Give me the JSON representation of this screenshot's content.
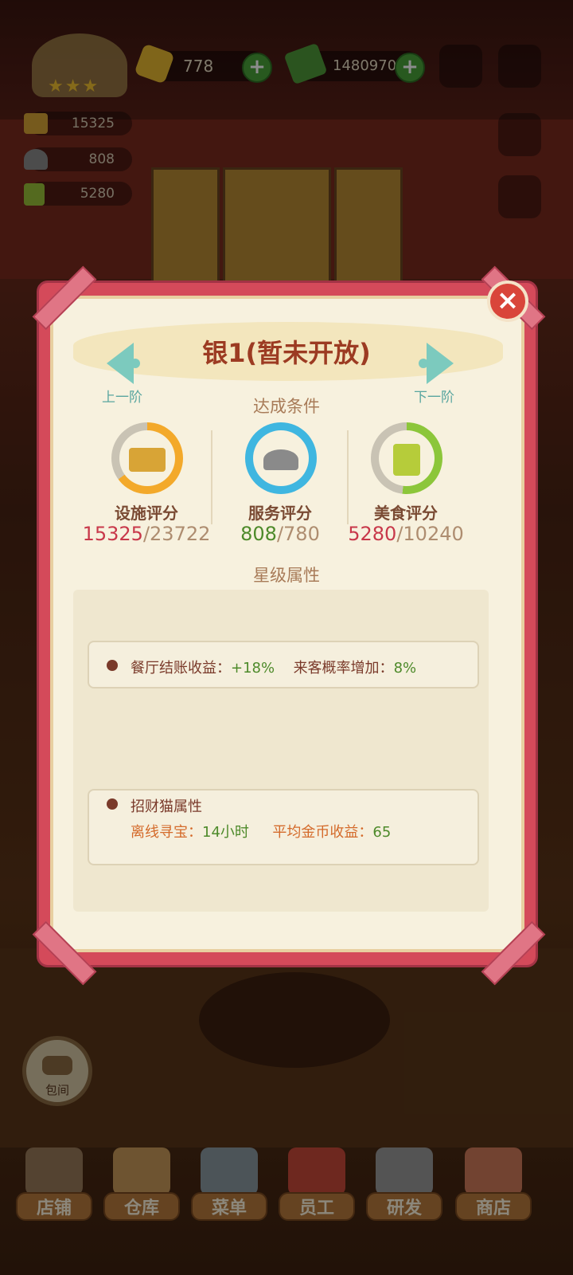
{
  "hud": {
    "gems": "778",
    "cash": "1480970",
    "stats": [
      {
        "icon": "facility-icon",
        "value": "15325"
      },
      {
        "icon": "service-icon",
        "value": "808"
      },
      {
        "icon": "food-icon",
        "value": "5280"
      }
    ]
  },
  "dialog": {
    "title": "银1(暂未开放)",
    "prev_label": "上一阶",
    "next_label": "下一阶",
    "conditions_label": "达成条件",
    "scores": [
      {
        "label": "设施评分",
        "current": "15325",
        "required": "/23722",
        "ring_color": "#f3a92a",
        "progress": 0.65
      },
      {
        "label": "服务评分",
        "current": "808",
        "required": "/780",
        "ring_color": "#3fb6e0",
        "progress": 1.0
      },
      {
        "label": "美食评分",
        "current": "5280",
        "required": "/10240",
        "ring_color": "#8cc63a",
        "progress": 0.52
      }
    ],
    "star_attr_label": "星级属性",
    "attr1": {
      "k1": "餐厅结账收益：",
      "v1": "+18%",
      "k2": "来客概率增加：",
      "v2": "8%"
    },
    "attr2": {
      "title": "招财猫属性",
      "k1": "离线寻宝：",
      "v1": "14小时",
      "k2": "平均金币收益：",
      "v2": "65"
    }
  },
  "room_button": "包间",
  "tabs": [
    {
      "label": "店铺",
      "icon": "shop-building-icon",
      "color": "#9a7a5a"
    },
    {
      "label": "仓库",
      "icon": "warehouse-box-icon",
      "color": "#c89a5a"
    },
    {
      "label": "菜单",
      "icon": "menu-clipboard-icon",
      "color": "#8a9aa0"
    },
    {
      "label": "员工",
      "icon": "staff-chef-icon",
      "color": "#c84a3a"
    },
    {
      "label": "研发",
      "icon": "research-pot-icon",
      "color": "#9a9a9a"
    },
    {
      "label": "商店",
      "icon": "store-stall-icon",
      "color": "#d07a5a"
    }
  ]
}
